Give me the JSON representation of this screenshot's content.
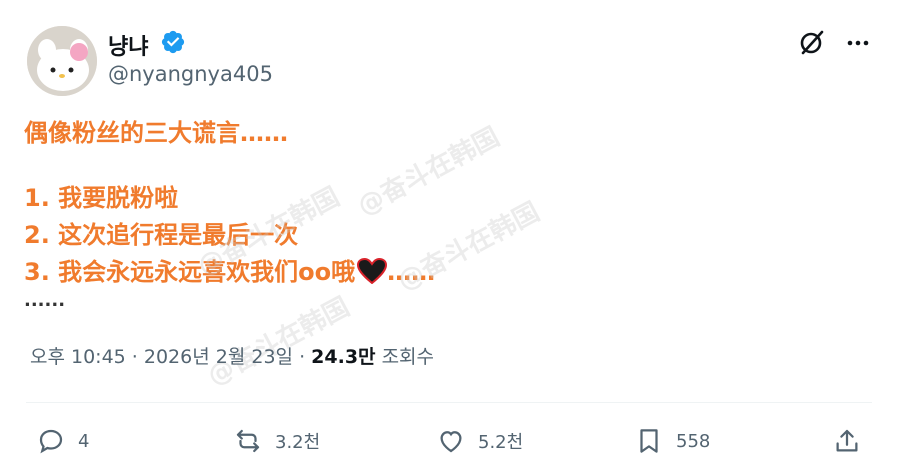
{
  "tweet": {
    "author": {
      "display_name": "냥냐",
      "handle": "@nyangnya405",
      "verified": true,
      "avatar_icon": "hello-kitty-avatar"
    },
    "lines": [
      "偶像粉丝的三大谎言……",
      "",
      "1. 我要脱粉啦",
      "2. 这次追行程是最后一次",
      "3. 我会永远永远喜欢我们oo哦",
      "......"
    ],
    "line3_trailing": "……",
    "emoji": "black-heart-emoji",
    "watermark_text": "@奋斗在韩国",
    "timestamp": "오후 10:45 · 2026년 2월 23일",
    "views_count": "24.3만",
    "views_label": "조회수"
  },
  "actions": {
    "reply_count": "4",
    "retweet_count": "3.2천",
    "like_count": "5.2천",
    "bookmark_count": "558"
  },
  "colors": {
    "accent_text": "#f07b2d",
    "verified_badge": "#1d9bf0",
    "secondary_text": "#536471"
  }
}
